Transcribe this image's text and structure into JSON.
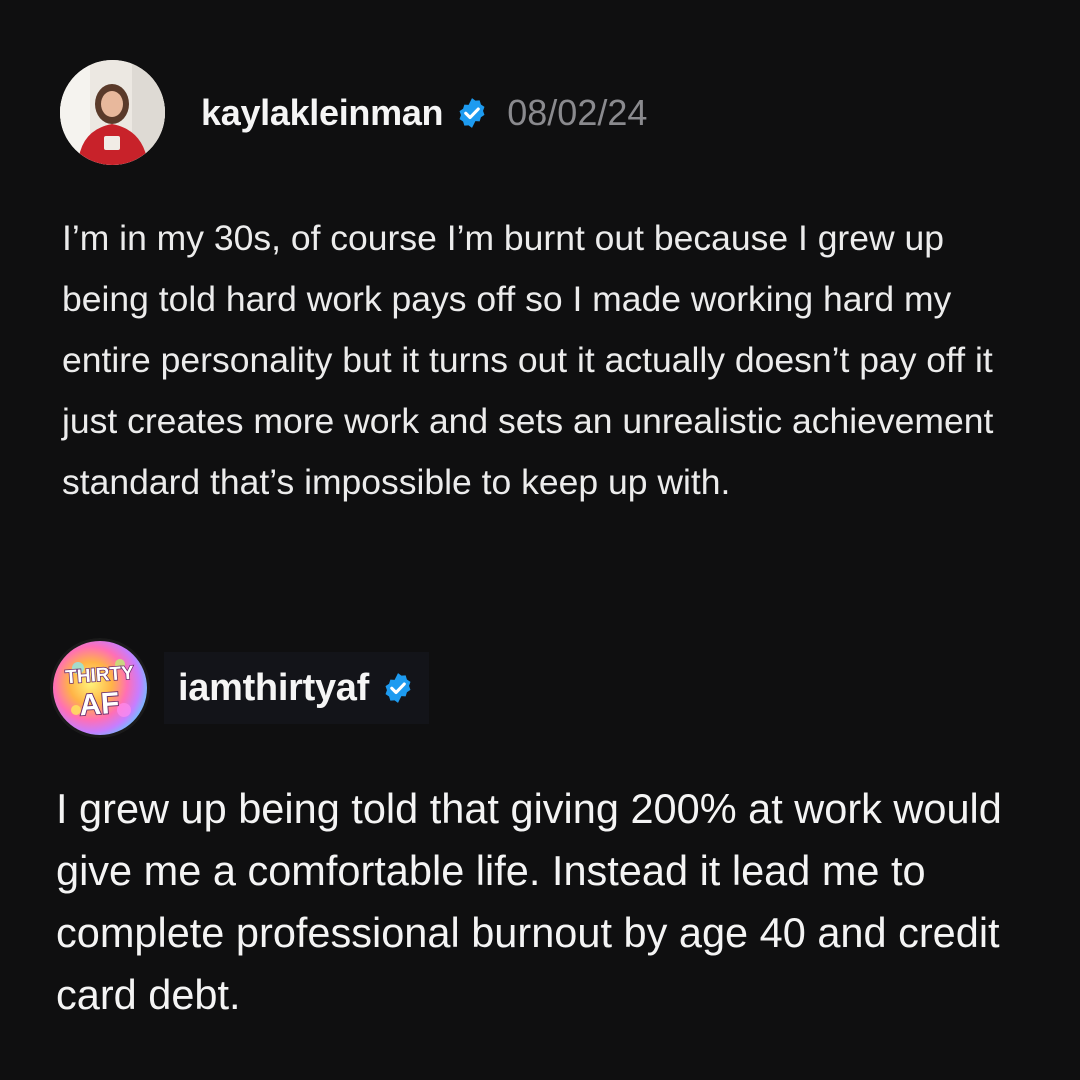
{
  "posts": [
    {
      "username": "kaylakleinman",
      "date": "08/02/24",
      "verified_icon": "verified-badge-icon",
      "avatar_icon": "profile-photo",
      "text": "I’m in my 30s, of course I’m burnt out because I grew up being told hard work pays off so I made working hard my entire personality but it turns out it actually doesn’t pay off it just creates more work and sets an unrealistic achievement standard that’s impossible to keep up with."
    },
    {
      "username": "iamthirtyaf",
      "verified_icon": "verified-badge-icon",
      "avatar_logo_text": [
        "THIRTY",
        "AF"
      ],
      "text": "I grew up being told that giving 200% at work would give me a comfortable life. Instead it lead me to complete professional burnout by age 40 and credit card debt."
    }
  ],
  "colors": {
    "background": "#0f0f10",
    "verified_blue": "#1d9bf0",
    "date_gray": "#8a8a8e"
  }
}
